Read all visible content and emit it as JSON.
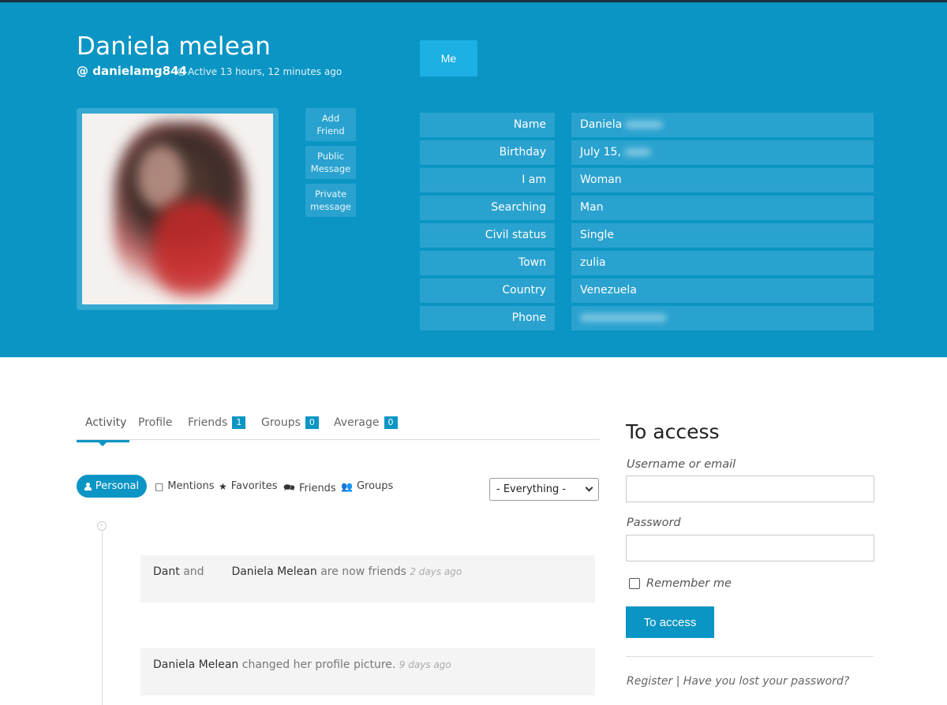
{
  "profile": {
    "name": "Daniela melean",
    "handle": "@ danielamg844",
    "active": "Active 13 hours, 12 minutes ago",
    "me_label": "Me",
    "actions": [
      "Add Friend",
      "Public Message",
      "Private message"
    ]
  },
  "details": [
    {
      "label": "Name",
      "value": "Daniela"
    },
    {
      "label": "Birthday",
      "value": "July 15,"
    },
    {
      "label": "I am",
      "value": "Woman"
    },
    {
      "label": "Searching",
      "value": "Man"
    },
    {
      "label": "Civil status",
      "value": "Single"
    },
    {
      "label": "Town",
      "value": "zulia"
    },
    {
      "label": "Country",
      "value": "Venezuela"
    },
    {
      "label": "Phone",
      "value": ""
    }
  ],
  "tabs": [
    {
      "label": "Activity"
    },
    {
      "label": "Profile"
    },
    {
      "label": "Friends",
      "count": "1"
    },
    {
      "label": "Groups",
      "count": "0"
    },
    {
      "label": "Average",
      "count": "0"
    }
  ],
  "filters": {
    "personal": "Personal",
    "mentions": "Mentions",
    "favorites": "Favorites",
    "friends": "Friends",
    "groups": "Groups",
    "select_value": "- Everything -"
  },
  "activities": [
    {
      "actor": "Dant",
      "connector": "and",
      "target": "Daniela Melean",
      "text": "are now friends",
      "time": "2 days ago"
    },
    {
      "actor": "Daniela Melean",
      "text": "changed her profile picture.",
      "time": "9 days ago"
    }
  ],
  "login": {
    "title": "To access",
    "username_label": "Username or email",
    "password_label": "Password",
    "remember_label": "Remember me",
    "button_label": "To access",
    "register_link": "Register",
    "separator": "|",
    "lost_password_link": "Have you lost your password?"
  },
  "colors": {
    "header_bg": "#0a95c4",
    "accent": "#0a95c4",
    "field_bg": "#2aa2cf"
  }
}
